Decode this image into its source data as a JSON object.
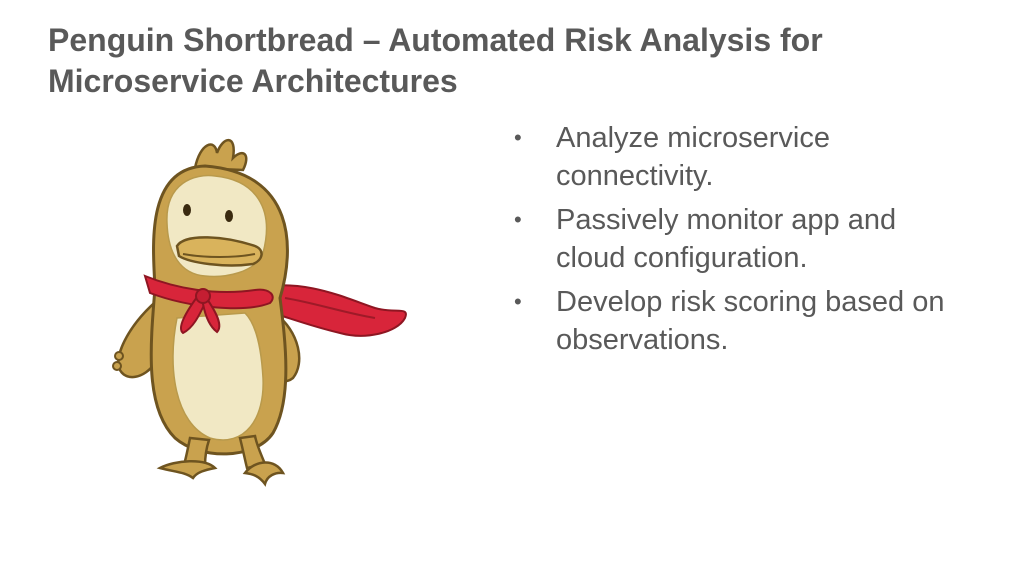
{
  "slide": {
    "title": "Penguin Shortbread – Automated Risk Analysis for Microservice Architectures",
    "bullets": [
      {
        "marker": "•",
        "text": "Analyze microservice connectivity."
      },
      {
        "marker": "•",
        "text": "Passively monitor app and cloud configuration."
      },
      {
        "marker": "•",
        "text": "Develop risk scoring based on observations."
      }
    ],
    "mascot": {
      "icon": "penguin-mascot-illustration",
      "body_color": "#C9A24E",
      "belly_color": "#F1E8C4",
      "scarf_color": "#D8253A"
    },
    "colors": {
      "text": "#595959",
      "background": "#FFFFFF"
    }
  }
}
